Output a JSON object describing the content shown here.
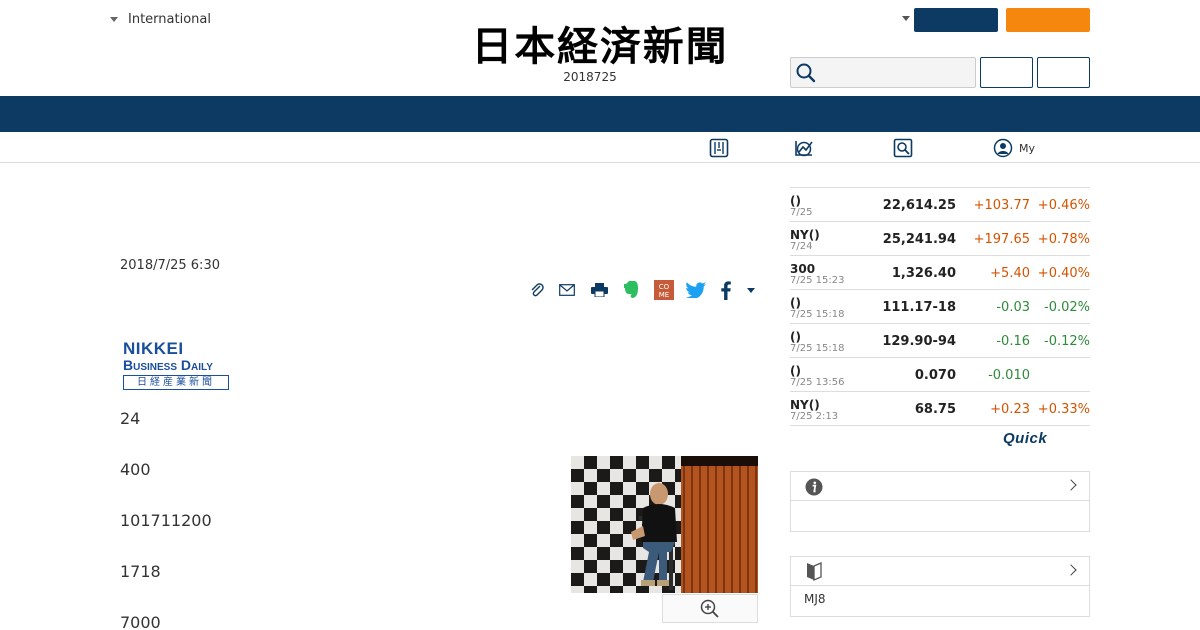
{
  "header": {
    "edition_label": "International",
    "logo_text": "日本経済新聞",
    "date": "2018725",
    "search_placeholder": ""
  },
  "subnav": {
    "my_label": "My"
  },
  "article": {
    "date": "2018/7/25 6:30",
    "paragraphs": [
      "24",
      "400",
      "101711200",
      "1718",
      "7000"
    ],
    "source_logo": {
      "line1": "NIKKEI",
      "line2": "Business Daily",
      "line3": "日経産業新聞"
    }
  },
  "share_icons": [
    "clip-icon",
    "mail-icon",
    "print-icon",
    "evernote-icon",
    "come-icon",
    "twitter-icon",
    "facebook-icon",
    "more-caret-icon"
  ],
  "market": {
    "rows": [
      {
        "name": "()",
        "date": "7/25",
        "value": "22,614.25",
        "change": "+103.77",
        "pct": "+0.46%",
        "dir": "up"
      },
      {
        "name": "NY()",
        "date": "7/24",
        "value": "25,241.94",
        "change": "+197.65",
        "pct": "+0.78%",
        "dir": "up"
      },
      {
        "name": "300",
        "date": "7/25 15:23",
        "value": "1,326.40",
        "change": "+5.40",
        "pct": "+0.40%",
        "dir": "up"
      },
      {
        "name": "()",
        "date": "7/25 15:18",
        "value": "111.17-18",
        "change": "-0.03",
        "pct": "-0.02%",
        "dir": "down"
      },
      {
        "name": "()",
        "date": "7/25 15:18",
        "value": "129.90-94",
        "change": "-0.16",
        "pct": "-0.12%",
        "dir": "down"
      },
      {
        "name": "()",
        "date": "7/25 13:56",
        "value": "0.070",
        "change": "-0.010",
        "pct": "",
        "dir": "down"
      },
      {
        "name": "NY()",
        "date": "7/25 2:13",
        "value": "68.75",
        "change": "+0.23",
        "pct": "+0.33%",
        "dir": "up"
      }
    ],
    "provider": "Quick"
  },
  "widgets": {
    "info": {
      "body": ""
    },
    "beginner": {
      "body": "MJ8"
    }
  },
  "colors": {
    "navy": "#0c3a63",
    "orange": "#f5870f",
    "up": "#d35400",
    "down": "#2e8b3a"
  }
}
